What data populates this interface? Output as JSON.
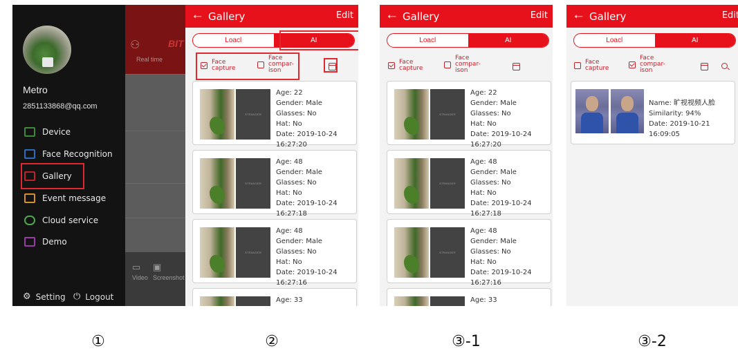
{
  "panel1": {
    "background_strip": {
      "brand": "BIT",
      "tab_label": "Real time",
      "bottom_labels": [
        "Video",
        "Screenshot"
      ]
    },
    "user": {
      "name": "Metro",
      "email": "2851133868@qq.com"
    },
    "menu": [
      {
        "label": "Device",
        "icon": "camera-icon",
        "color": "#3a8a3a"
      },
      {
        "label": "Face Recognition",
        "icon": "face-scan-icon",
        "color": "#2c6cc0"
      },
      {
        "label": "Gallery",
        "icon": "gallery-icon",
        "color": "#c0222c"
      },
      {
        "label": "Event message",
        "icon": "message-icon",
        "color": "#d4912a"
      },
      {
        "label": "Cloud service",
        "icon": "cloud-icon",
        "color": "#4fa84f"
      },
      {
        "label": "Demo",
        "icon": "demo-icon",
        "color": "#9a3aa8"
      }
    ],
    "footer": {
      "setting": "Setting",
      "logout": "Logout"
    }
  },
  "gallery": {
    "title": "Gallery",
    "edit": "Edit",
    "tabs": {
      "local": "Loacl",
      "ai": "AI"
    },
    "filters": {
      "face_capture": [
        "Face",
        "capture"
      ],
      "face_comparison": [
        "Face",
        "compar-",
        "ison"
      ]
    },
    "stranger_label": "STRANGER",
    "records": [
      {
        "age": "Age: 22",
        "gender": "Gender: Male",
        "glasses": "Glasses: No",
        "hat": "Hat: No",
        "date": "Date: 2019-10-24 16:27:20"
      },
      {
        "age": "Age: 48",
        "gender": "Gender: Male",
        "glasses": "Glasses: No",
        "hat": "Hat: No",
        "date": "Date: 2019-10-24 16:27:18"
      },
      {
        "age": "Age: 48",
        "gender": "Gender: Male",
        "glasses": "Glasses: No",
        "hat": "Hat: No",
        "date": "Date: 2019-10-24 16:27:16"
      },
      {
        "age": "Age: 33"
      }
    ],
    "comparison": {
      "name": "Name: 旷视视频人脸",
      "similarity": "Similarity: 94%",
      "date": "Date: 2019-10-21 16:09:05"
    }
  },
  "captions": [
    "①",
    "②",
    "③-1",
    "③-2"
  ],
  "colors": {
    "accent": "#e7111b",
    "highlight_box": "#e0282e"
  }
}
